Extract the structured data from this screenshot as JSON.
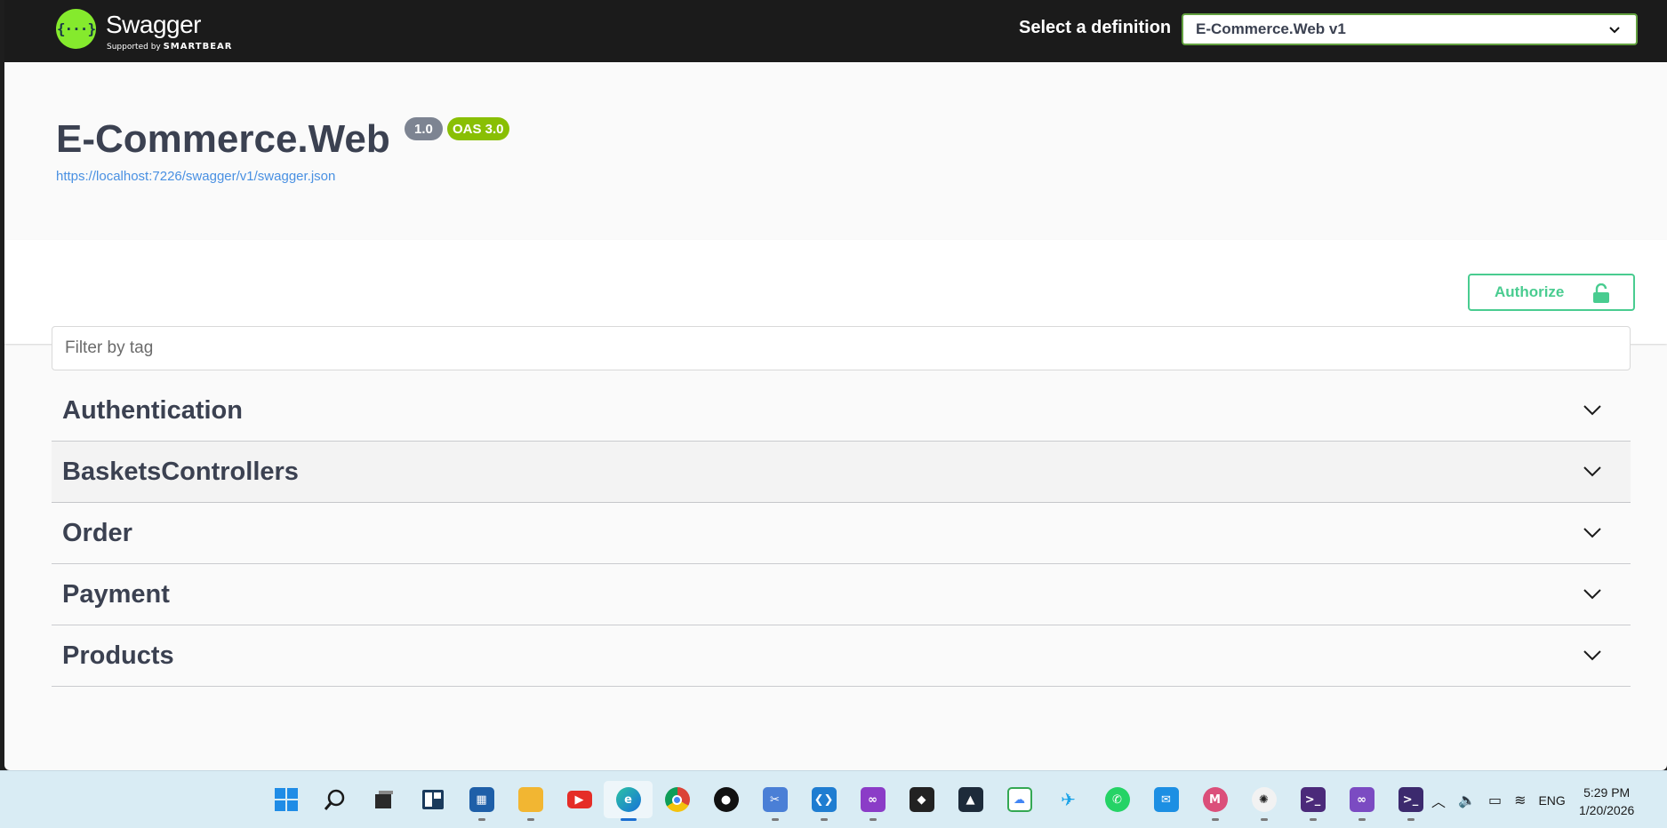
{
  "header": {
    "logo_glyph": "{···}",
    "logo_name": "Swagger",
    "logo_sub_prefix": "Supported by",
    "logo_sub_brand": "SMARTBEAR",
    "definition_label": "Select a definition",
    "definition_selected": "E-Commerce.Web v1"
  },
  "info": {
    "title": "E-Commerce.Web",
    "version": "1.0",
    "oas": "OAS 3.0",
    "url": "https://localhost:7226/swagger/v1/swagger.json"
  },
  "scheme": {
    "authorize_label": "Authorize"
  },
  "filter": {
    "placeholder": "Filter by tag"
  },
  "tags": [
    {
      "name": "Authentication"
    },
    {
      "name": "BasketsControllers"
    },
    {
      "name": "Order"
    },
    {
      "name": "Payment"
    },
    {
      "name": "Products"
    }
  ],
  "taskbar": {
    "apps": [
      "start",
      "search",
      "task-view",
      "widgets",
      "store",
      "file-explorer",
      "youtube",
      "edge",
      "chrome",
      "github",
      "snipping",
      "vscode",
      "visual-studio-preview",
      "unity",
      "arc",
      "google-cloud",
      "paw",
      "whatsapp",
      "mail",
      "chrome-profile",
      "chatgpt",
      "terminal",
      "visual-studio",
      "terminal-2"
    ],
    "language": "ENG",
    "time": "5:29 PM",
    "date": "1/20/2026"
  },
  "colors": {
    "topbar": "#1b1b1b",
    "swagger_green": "#85ea2d",
    "authorize_green": "#49cc90",
    "oas_green": "#89bf04",
    "version_grey": "#7d8492",
    "text_dark": "#3b4151",
    "link_blue": "#4990e2"
  }
}
